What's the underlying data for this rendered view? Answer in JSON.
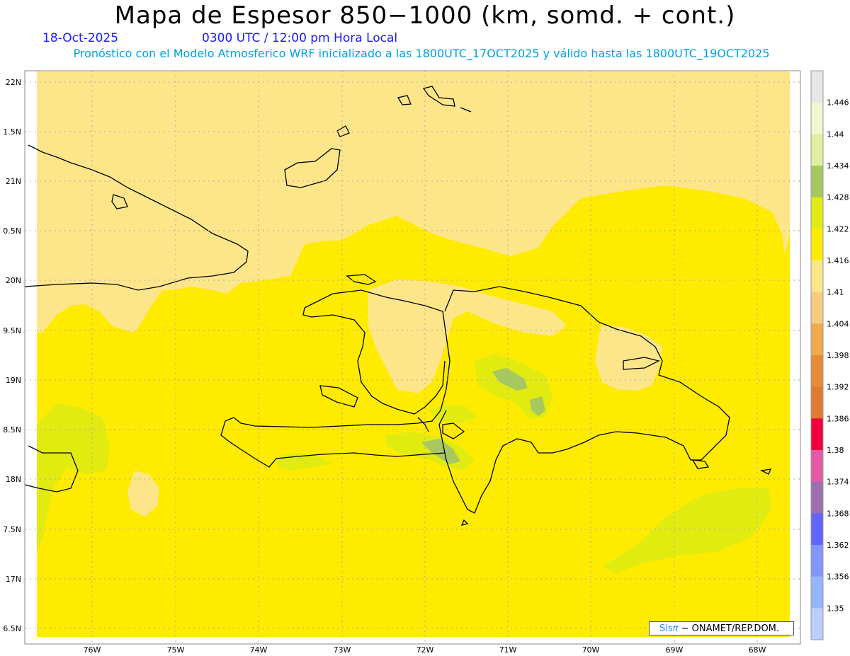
{
  "header": {
    "title": "Mapa de Espesor 850−1000 (km, somd. + cont.)",
    "date": "18-Oct-2025",
    "time": "0300 UTC / 12:00 pm Hora Local",
    "description": "Pronóstico con el Modelo Atmosferico WRF inicializado a las 1800UTC_17OCT2025 y válido hasta las  1800UTC_19OCT2025"
  },
  "axes": {
    "lat_labels": [
      "22N",
      "1.5N",
      "21N",
      "0.5N",
      "20N",
      "9.5N",
      "19N",
      "8.5N",
      "18N",
      "7.5N",
      "17N",
      "6.5N"
    ],
    "lon_labels": [
      "76W",
      "75W",
      "74W",
      "73W",
      "72W",
      "71W",
      "70W",
      "69W",
      "68W"
    ]
  },
  "colorbar": {
    "levels": [
      "1.446",
      "1.44",
      "1.434",
      "1.428",
      "1.422",
      "1.416",
      "1.41",
      "1.404",
      "1.398",
      "1.392",
      "1.386",
      "1.38",
      "1.374",
      "1.368",
      "1.362",
      "1.356",
      "1.35"
    ],
    "colors": [
      "#e6e6e6",
      "#f0f5d2",
      "#e1f0a0",
      "#a6c85f",
      "#e1eb10",
      "#ffeb00",
      "#fde68a",
      "#f5cd80",
      "#f0aa4b",
      "#e68c37",
      "#e07a32",
      "#f0003c",
      "#e65aa5",
      "#9e6eaf",
      "#6464ff",
      "#8296ff",
      "#96b4ff",
      "#bccdff"
    ]
  },
  "colors": {
    "background_field": "#ffeb00",
    "north_field": "#fde68a",
    "green_patch": "#e1eb10",
    "dark_patch": "#a6c85f",
    "coast": "#000000"
  },
  "credit": {
    "sis": "Sis",
    "pi": "π",
    "rest": "− ONAMET/REP.DOM."
  }
}
